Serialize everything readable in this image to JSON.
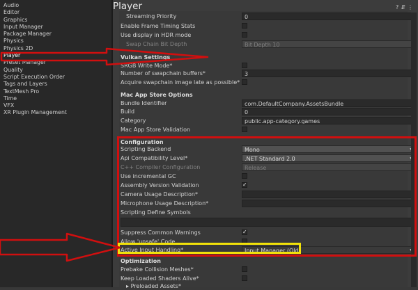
{
  "sidebar": {
    "items": [
      "Audio",
      "Editor",
      "Graphics",
      "Input Manager",
      "Package Manager",
      "Physics",
      "Physics 2D",
      "Player",
      "Preset Manager",
      "Quality",
      "Script Execution Order",
      "Tags and Layers",
      "TextMesh Pro",
      "Time",
      "VFX",
      "XR Plugin Management"
    ],
    "selected": "Player"
  },
  "header": {
    "title": "Player",
    "help_icon": "?",
    "settings_icon": "⇵",
    "menu_icon": "⋮"
  },
  "rows": {
    "streaming_priority": {
      "label": "Streaming Priority",
      "value": "0"
    },
    "frame_timing": {
      "label": "Enable Frame Timing Stats",
      "checked": false
    },
    "hdr_display": {
      "label": "Use display in HDR mode",
      "checked": false
    },
    "swap_chain": {
      "label": "Swap Chain Bit Depth",
      "value": "Bit Depth 10"
    },
    "vulkan_header": "Vulkan Settings",
    "srgb_write": {
      "label": "SRGB Write Mode*",
      "checked": false
    },
    "swapchain_buffers": {
      "label": "Number of swapchain buffers*",
      "value": "3"
    },
    "acquire_late": {
      "label": "Acquire swapchain image late as possible*",
      "checked": false
    },
    "mac_header": "Mac App Store Options",
    "bundle_id": {
      "label": "Bundle Identifier",
      "value": "com.DefaultCompany.AssetsBundle"
    },
    "build": {
      "label": "Build",
      "value": "0"
    },
    "category": {
      "label": "Category",
      "value": "public.app-category.games"
    },
    "mac_validation": {
      "label": "Mac App Store Validation",
      "checked": false
    },
    "config_header": "Configuration",
    "scripting_backend": {
      "label": "Scripting Backend",
      "value": "Mono"
    },
    "api_compat": {
      "label": "Api Compatibility Level*",
      "value": ".NET Standard 2.0"
    },
    "cpp_config": {
      "label": "C++ Compiler Configuration",
      "value": "Release"
    },
    "incremental_gc": {
      "label": "Use incremental GC",
      "checked": false
    },
    "assembly_validation": {
      "label": "Assembly Version Validation",
      "checked": true
    },
    "camera_usage": {
      "label": "Camera Usage Description*",
      "value": ""
    },
    "mic_usage": {
      "label": "Microphone Usage Description*",
      "value": ""
    },
    "define_symbols": {
      "label": "Scripting Define Symbols",
      "value": ""
    },
    "suppress_warnings": {
      "label": "Suppress Common Warnings",
      "checked": true
    },
    "allow_unsafe": {
      "label": "Allow 'unsafe' Code",
      "checked": false
    },
    "active_input": {
      "label": "Active Input Handling*",
      "value": "Input Manager (Old)"
    },
    "opt_header": "Optimization",
    "prebake": {
      "label": "Prebake Collision Meshes*",
      "checked": false
    },
    "keep_shaders": {
      "label": "Keep Loaded Shaders Alive*",
      "checked": false
    },
    "preloaded": {
      "label": "Preloaded Assets*"
    }
  },
  "colors": {
    "highlight_red": "#d10f0f",
    "highlight_yellow": "#f2e20a"
  }
}
